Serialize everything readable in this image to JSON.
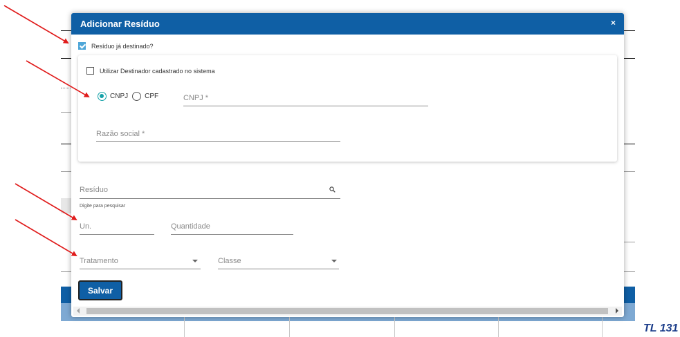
{
  "modal": {
    "title": "Adicionar Resíduo",
    "close_glyph": "×",
    "destinado_label": "Resíduo já destinado?",
    "destinado_checked": true
  },
  "card": {
    "utilizar_label": "Utilizar Destinador cadastrado no sistema",
    "utilizar_checked": false,
    "radio_cnpj_label": "CNPJ",
    "radio_cpf_label": "CPF",
    "radio_selected": "CNPJ",
    "cnpj_placeholder": "CNPJ *",
    "razao_placeholder": "Razão social *"
  },
  "form": {
    "residuo_placeholder": "Resíduo",
    "residuo_hint": "Digite para pesquisar",
    "un_placeholder": "Un.",
    "quantidade_placeholder": "Quantidade",
    "tratamento_placeholder": "Tratamento",
    "classe_placeholder": "Classe",
    "save_label": "Salvar"
  },
  "annotation_tag": "TL 131",
  "colors": {
    "header": "#0f5fa5",
    "check": "#4ea6d8",
    "radio": "#14a1a8",
    "arrow": "#e01b1b"
  },
  "icons": [
    "close-icon",
    "search-icon",
    "chevron-down-icon",
    "check-icon"
  ]
}
